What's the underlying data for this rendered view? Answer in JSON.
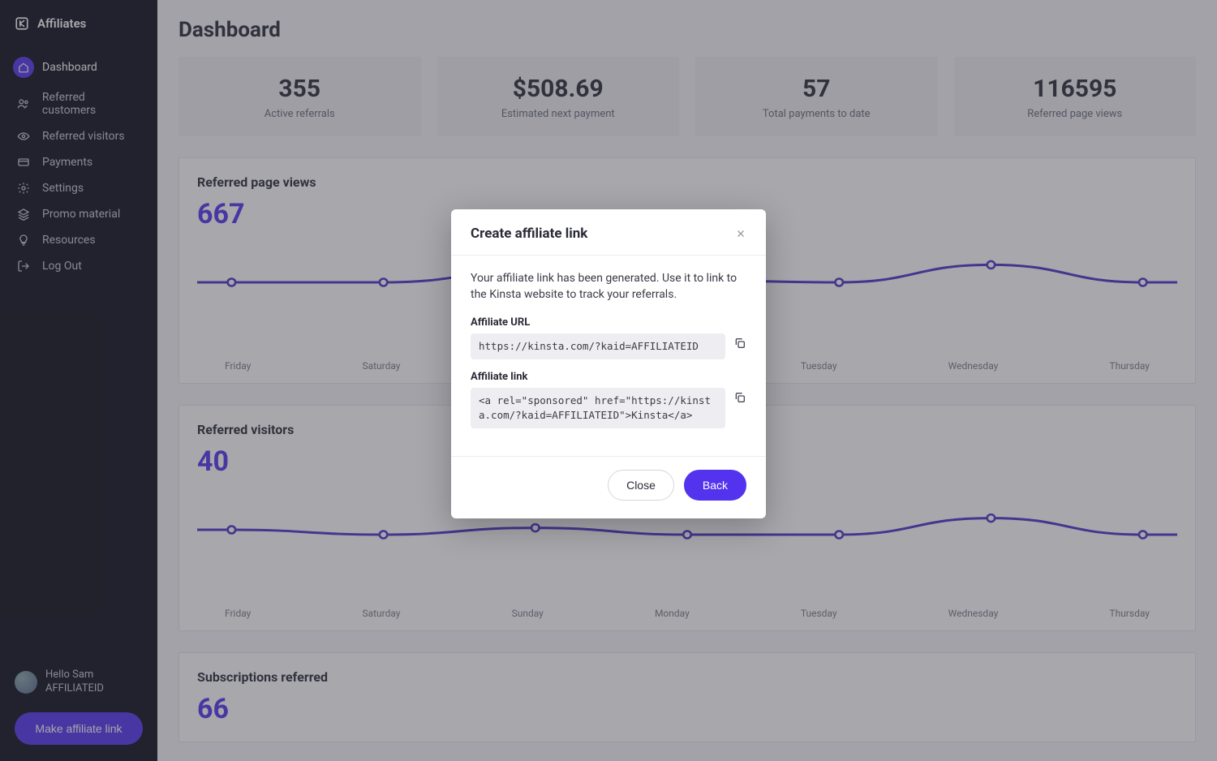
{
  "brand": {
    "name": "Affiliates"
  },
  "sidebar": {
    "items": [
      {
        "label": "Dashboard",
        "icon": "home-icon",
        "active": true
      },
      {
        "label": "Referred customers",
        "icon": "users-icon"
      },
      {
        "label": "Referred visitors",
        "icon": "eye-icon"
      },
      {
        "label": "Payments",
        "icon": "card-icon"
      },
      {
        "label": "Settings",
        "icon": "gear-icon"
      },
      {
        "label": "Promo material",
        "icon": "layers-icon"
      },
      {
        "label": "Resources",
        "icon": "bulb-icon"
      },
      {
        "label": "Log Out",
        "icon": "logout-icon"
      }
    ]
  },
  "user": {
    "greeting": "Hello Sam",
    "id": "AFFILIATEID"
  },
  "make_link_label": "Make affiliate link",
  "page_title": "Dashboard",
  "stats": [
    {
      "value": "355",
      "label": "Active referrals"
    },
    {
      "value": "$508.69",
      "label": "Estimated next payment"
    },
    {
      "value": "57",
      "label": "Total payments to date"
    },
    {
      "value": "116595",
      "label": "Referred page views"
    }
  ],
  "cards": {
    "pageviews": {
      "title": "Referred page views",
      "value": "667"
    },
    "visitors": {
      "title": "Referred visitors",
      "value": "40"
    },
    "subs": {
      "title": "Subscriptions referred",
      "value": "66"
    }
  },
  "chart_data": [
    {
      "type": "line",
      "title": "Referred page views",
      "categories": [
        "Friday",
        "Saturday",
        "Sunday",
        "Monday",
        "Tuesday",
        "Wednesday",
        "Thursday"
      ],
      "values": [
        60,
        60,
        72,
        62,
        60,
        78,
        60
      ],
      "ylim": [
        0,
        100
      ]
    },
    {
      "type": "line",
      "title": "Referred visitors",
      "categories": [
        "Friday",
        "Saturday",
        "Sunday",
        "Monday",
        "Tuesday",
        "Wednesday",
        "Thursday"
      ],
      "values": [
        60,
        55,
        62,
        55,
        55,
        72,
        55
      ],
      "ylim": [
        0,
        100
      ]
    }
  ],
  "xcats": [
    "Friday",
    "Saturday",
    "Sunday",
    "Monday",
    "Tuesday",
    "Wednesday",
    "Thursday"
  ],
  "modal": {
    "title": "Create affiliate link",
    "intro": "Your affiliate link has been generated. Use it to link to the Kinsta website to track your referrals.",
    "url_label": "Affiliate URL",
    "url_value": "https://kinsta.com/?kaid=AFFILIATEID",
    "link_label": "Affiliate link",
    "link_value": "<a rel=\"sponsored\" href=\"https://kinsta.com/?kaid=AFFILIATEID\">Kinsta</a>",
    "close": "Close",
    "back": "Back"
  }
}
